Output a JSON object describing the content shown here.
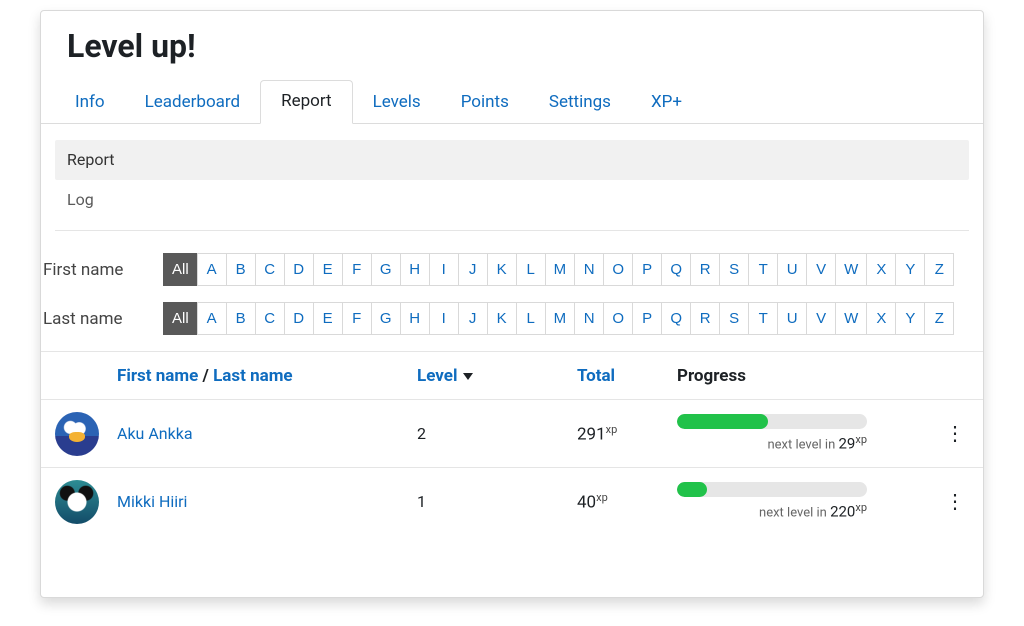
{
  "title": "Level up!",
  "tabs": [
    "Info",
    "Leaderboard",
    "Report",
    "Levels",
    "Points",
    "Settings",
    "XP+"
  ],
  "activeTab": "Report",
  "subnav": {
    "items": [
      "Report",
      "Log"
    ],
    "active": "Report"
  },
  "filters": {
    "firstLabel": "First name",
    "lastLabel": "Last name",
    "allLabel": "All",
    "letters": [
      "A",
      "B",
      "C",
      "D",
      "E",
      "F",
      "G",
      "H",
      "I",
      "J",
      "K",
      "L",
      "M",
      "N",
      "O",
      "P",
      "Q",
      "R",
      "S",
      "T",
      "U",
      "V",
      "W",
      "X",
      "Y",
      "Z"
    ],
    "firstSelected": "All",
    "lastSelected": "All"
  },
  "table": {
    "headers": {
      "firstName": "First name",
      "separator": " / ",
      "lastName": "Last name",
      "level": "Level",
      "total": "Total",
      "progress": "Progress"
    },
    "xpUnit": "xp",
    "nextLevelPrefix": "next level in ",
    "rows": [
      {
        "name": "Aku Ankka",
        "level": "2",
        "total": "291",
        "progressPct": 48,
        "nextLevelIn": "29"
      },
      {
        "name": "Mikki Hiiri",
        "level": "1",
        "total": "40",
        "progressPct": 16,
        "nextLevelIn": "220"
      }
    ]
  }
}
